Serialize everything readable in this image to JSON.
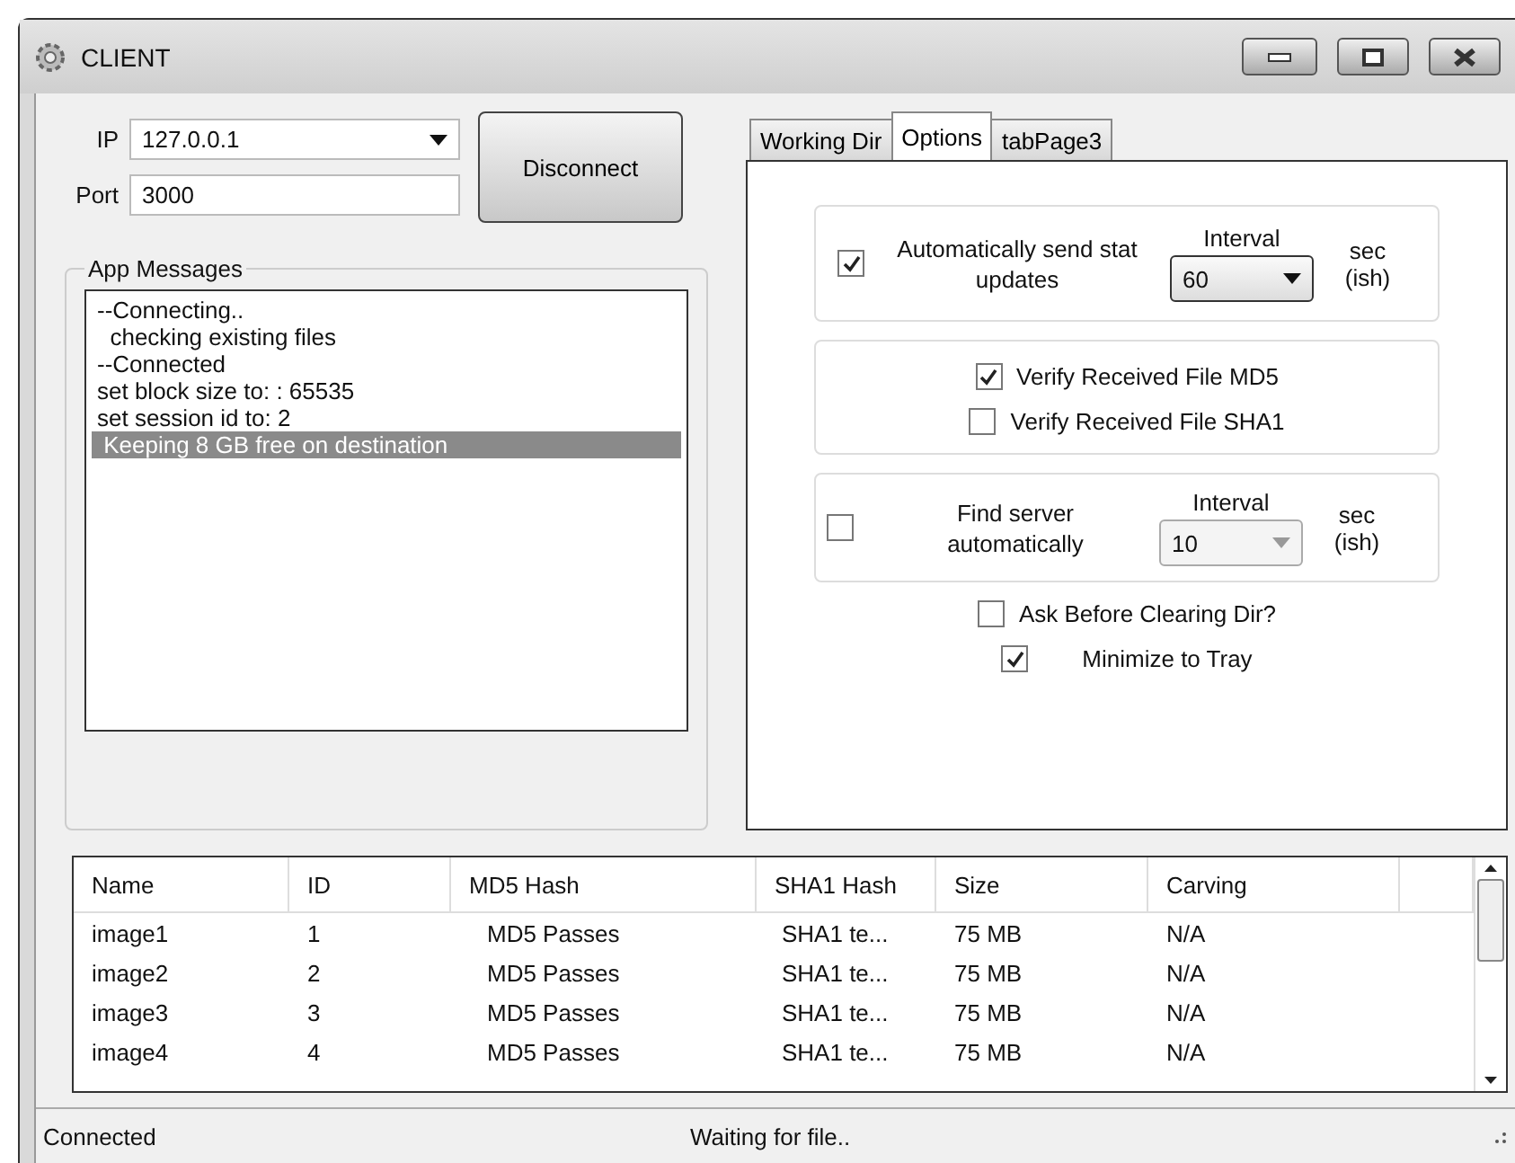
{
  "window": {
    "title": "CLIENT"
  },
  "connection": {
    "ip_label": "IP",
    "ip_value": "127.0.0.1",
    "port_label": "Port",
    "port_value": "3000",
    "button": "Disconnect"
  },
  "messages": {
    "title": "App Messages",
    "items": [
      {
        "text": "--Connecting..",
        "selected": false
      },
      {
        "text": "  checking existing files",
        "selected": false
      },
      {
        "text": "--Connected",
        "selected": false
      },
      {
        "text": "set block size to: : 65535",
        "selected": false
      },
      {
        "text": "set session id to: 2",
        "selected": false
      },
      {
        "text": " Keeping 8 GB free on destination",
        "selected": true
      }
    ]
  },
  "tabs": [
    {
      "label": "Working Dir",
      "selected": false
    },
    {
      "label": "Options",
      "selected": true
    },
    {
      "label": "tabPage3",
      "selected": false
    }
  ],
  "options": {
    "stat_updates": {
      "label": "Automatically send stat updates",
      "checked": true,
      "interval_label": "Interval",
      "interval": "60",
      "disabled": false,
      "unit": "sec (ish)"
    },
    "verify": [
      {
        "label": "Verify Received File MD5",
        "checked": true
      },
      {
        "label": "Verify Received File SHA1",
        "checked": false
      }
    ],
    "find_server": {
      "label": "Find server automatically",
      "checked": false,
      "interval_label": "Interval",
      "interval": "10",
      "disabled": true,
      "unit": "sec (ish)"
    },
    "ask_clear": {
      "label": "Ask Before Clearing Dir?",
      "checked": false
    },
    "minimize": {
      "label": "Minimize to Tray",
      "checked": true
    }
  },
  "table": {
    "columns": [
      "Name",
      "ID",
      "MD5 Hash",
      "SHA1 Hash",
      "Size",
      "Carving"
    ],
    "rows": [
      [
        "image1",
        "1",
        "MD5 Passes",
        "SHA1 te...",
        "75 MB",
        "N/A"
      ],
      [
        "image2",
        "2",
        "MD5 Passes",
        "SHA1 te...",
        "75 MB",
        "N/A"
      ],
      [
        "image3",
        "3",
        "MD5 Passes",
        "SHA1 te...",
        "75 MB",
        "N/A"
      ],
      [
        "image4",
        "4",
        "MD5 Passes",
        "SHA1 te...",
        "75 MB",
        "N/A"
      ]
    ]
  },
  "status_bar": {
    "left": "Connected",
    "center": "Waiting for file.."
  }
}
